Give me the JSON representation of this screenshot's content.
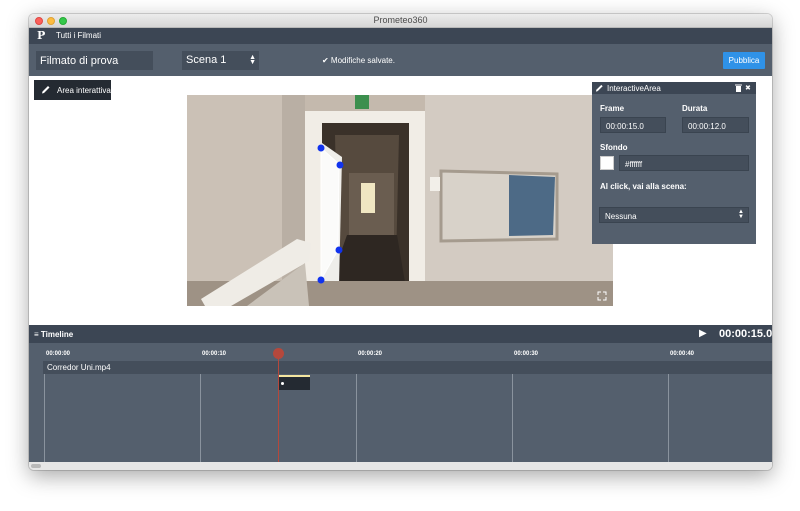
{
  "window": {
    "title": "Prometeo360"
  },
  "navbar": {
    "logo": "P",
    "all_videos": "Tutti i Filmati"
  },
  "toolbar": {
    "video_title": "Filmato di prova",
    "scene_select": "Scena 1",
    "status": "✔ Modifiche salvate.",
    "publish_label": "Pubblica",
    "accent_color": "#2f92e8"
  },
  "editor": {
    "interactive_area_label": "Area interattiva"
  },
  "panel": {
    "title": "InteractiveArea",
    "frame_label": "Frame",
    "frame_value": "00:00:15.0",
    "duration_label": "Durata",
    "duration_value": "00:00:12.0",
    "background_label": "Sfondo",
    "background_value": "#ffffff",
    "on_click_label": "Al click, vai alla scena:",
    "on_click_value": "Nessuna"
  },
  "timeline": {
    "title": "Timeline",
    "current_time": "00:00:15.0",
    "ticks": [
      "00:00:00",
      "00:00:10",
      "00:00:20",
      "00:00:30",
      "00:00:40"
    ],
    "track_name": "Corredor Uni.mp4",
    "playhead_color": "#b5483c"
  },
  "icons": {
    "pencil": "pencil-icon",
    "delete": "trash-icon",
    "close": "close-icon",
    "play": "play-icon",
    "fullscreen": "fullscreen-icon",
    "timeline": "timeline-icon"
  }
}
